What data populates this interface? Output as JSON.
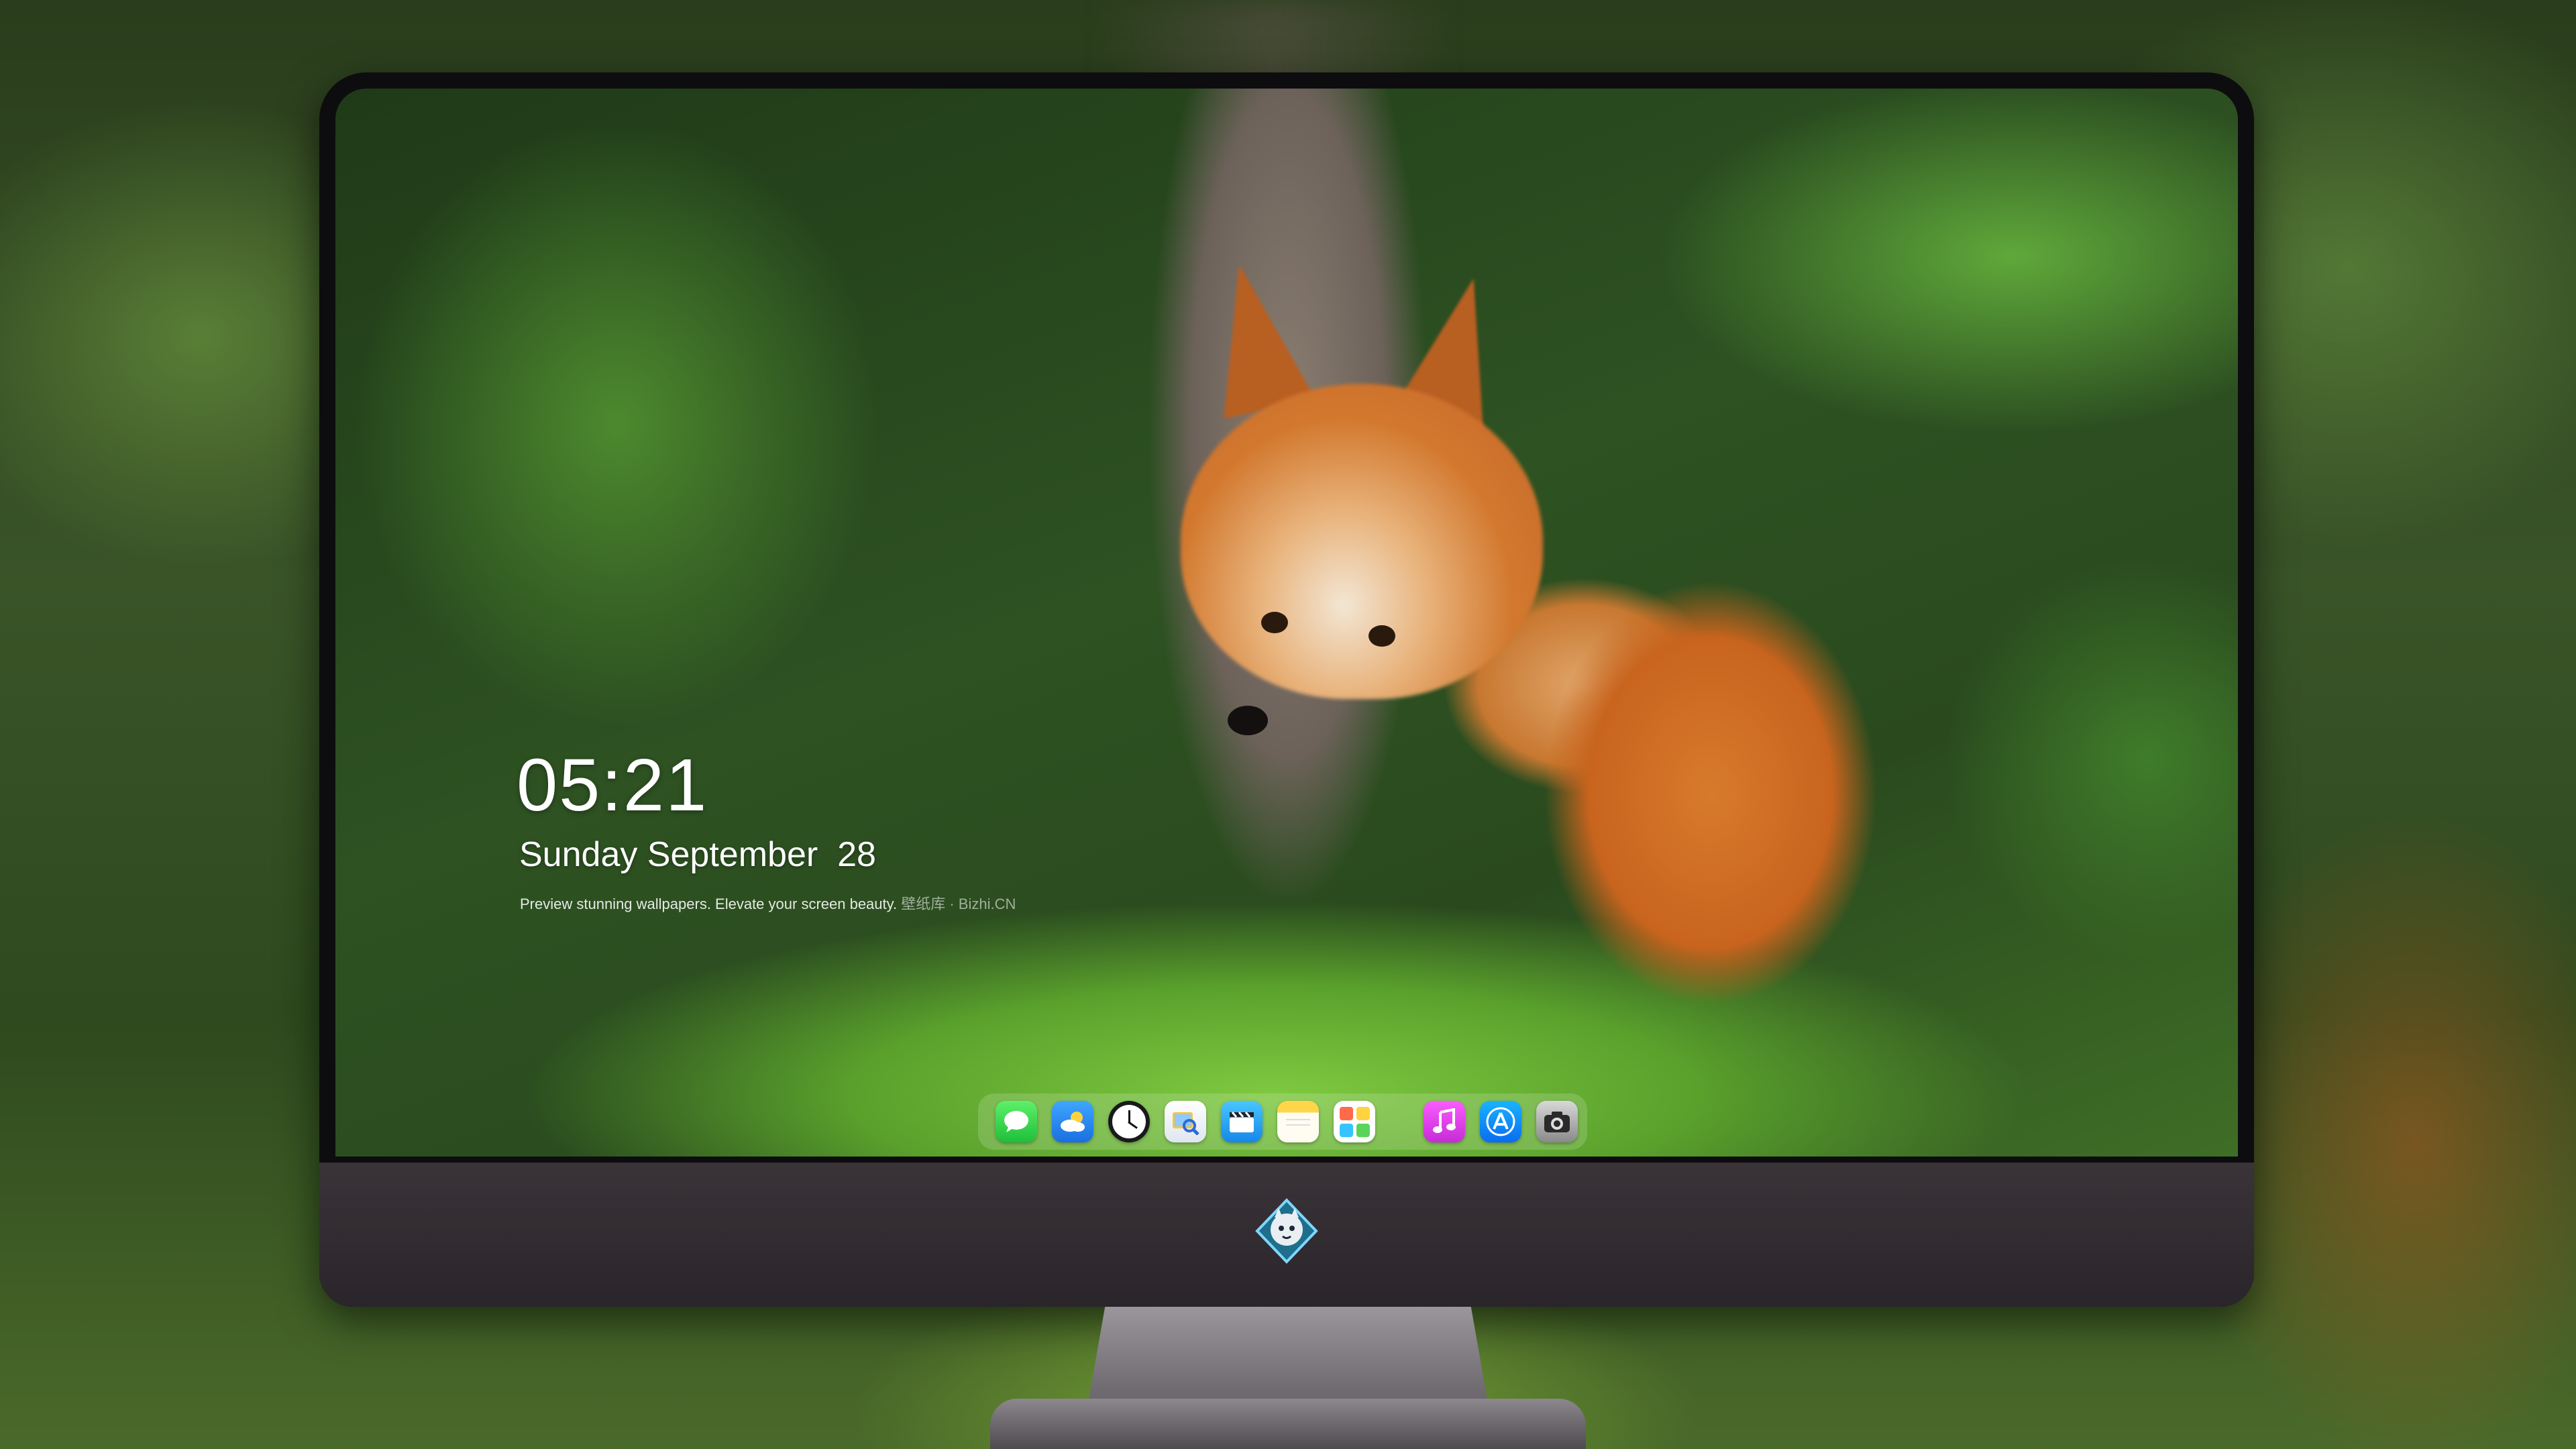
{
  "lockscreen": {
    "time": "05:21",
    "date": "Sunday September  28",
    "tagline": "Preview stunning wallpapers. Elevate your screen beauty.",
    "tagline_link": "壁纸库 · Bizhi.CN"
  },
  "dock": {
    "apps": [
      {
        "name": "Messages",
        "icon": "speech-bubble"
      },
      {
        "name": "Weather",
        "icon": "cloud-sun"
      },
      {
        "name": "Clock",
        "icon": "clock"
      },
      {
        "name": "Preview",
        "icon": "magnifier-photo"
      },
      {
        "name": "Clips",
        "icon": "clapperboard"
      },
      {
        "name": "Notes",
        "icon": "notepad"
      },
      {
        "name": "Photo Booth",
        "icon": "photo-grid"
      },
      {
        "name": "Music",
        "icon": "music-note"
      },
      {
        "name": "App Store",
        "icon": "app-store-a"
      },
      {
        "name": "Camera",
        "icon": "camera"
      }
    ]
  },
  "colors": {
    "monitor_bezel": "#0d0d0f",
    "monitor_chin": "#3a3439",
    "dock_bg": "rgba(255,255,255,0.16)"
  }
}
